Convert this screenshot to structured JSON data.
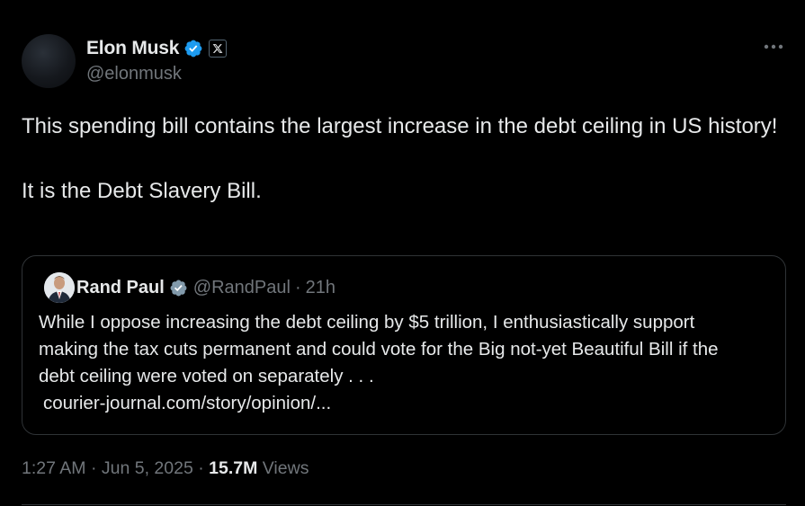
{
  "author": {
    "display_name": "Elon Musk",
    "handle": "@elonmusk",
    "verified_color": "#1d9bf0",
    "affiliate_badge_icon": "x-logo-icon"
  },
  "tweet": {
    "text": "This spending bill contains the largest increase in the debt ceiling in US history!\n\nIt is the Debt Slavery Bill."
  },
  "quoted_tweet": {
    "display_name": "Rand Paul",
    "handle": "@RandPaul",
    "separator": "·",
    "time_ago": "21h",
    "text": "While I oppose increasing the debt ceiling by $5 trillion, I enthusiastically support making the tax cuts permanent and could vote for the Big not-yet Beautiful Bill if the debt ceiling were voted on separately . . .",
    "link": "courier-journal.com/story/opinion/..."
  },
  "meta": {
    "time": "1:27 AM",
    "dot1": "·",
    "date": "Jun 5, 2025",
    "dot2": "·",
    "views_count": "15.7M",
    "views_label": "Views"
  },
  "colors": {
    "background": "#000000",
    "text_primary": "#e7e9ea",
    "text_secondary": "#71767b",
    "border": "#2f3336",
    "verified_blue": "#1d9bf0"
  },
  "icons": {
    "more": "more-horizontal-icon",
    "verified": "verified-badge-icon"
  }
}
